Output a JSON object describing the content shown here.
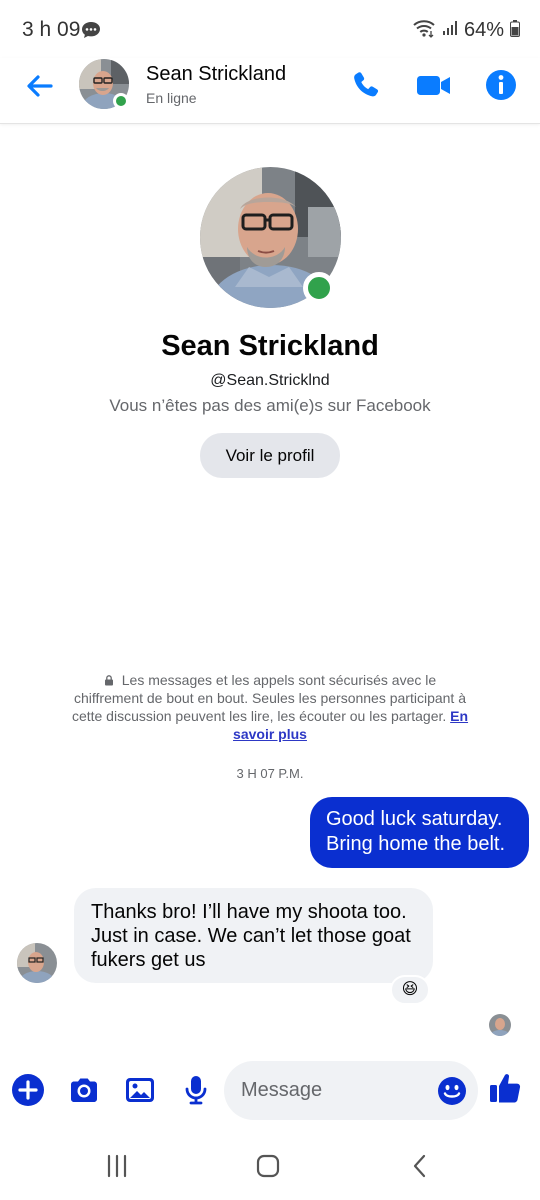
{
  "status_bar": {
    "time": "3 h 09",
    "battery": "64%",
    "icons": [
      "chat-bubble-icon",
      "wifi-icon",
      "signal-icon",
      "battery-icon"
    ]
  },
  "header": {
    "name": "Sean Strickland",
    "status": "En ligne",
    "icons": [
      "back-arrow-icon",
      "phone-icon",
      "video-icon",
      "info-icon"
    ]
  },
  "profile": {
    "name": "Sean Strickland",
    "handle": "@Sean.Stricklnd",
    "friend_status": "Vous n’êtes pas des ami(e)s sur Facebook",
    "view_profile_label": "Voir le profil"
  },
  "encryption_notice": {
    "text": "Les messages et les appels sont sécurisés avec le chiffrement de bout en bout. Seules les personnes participant à cette discussion peuvent les lire, les écouter ou les partager.",
    "link": "En savoir plus"
  },
  "conversation": {
    "timestamp": "3 H 07 P.M.",
    "messages": [
      {
        "direction": "outgoing",
        "lines": [
          "Good luck saturday.",
          "Bring home the belt."
        ]
      },
      {
        "direction": "incoming",
        "lines": [
          "Thanks bro! I’ll have my shoota too.",
          "Just in case. We can’t let those goat",
          "fukers get us"
        ],
        "reaction": "😆"
      }
    ]
  },
  "composer": {
    "placeholder": "Message",
    "icons": [
      "plus-icon",
      "camera-icon",
      "gallery-icon",
      "microphone-icon",
      "emoji-icon",
      "thumbs-up-icon"
    ]
  },
  "system_nav": {
    "icons": [
      "recent-apps-icon",
      "home-icon",
      "back-icon"
    ]
  },
  "colors": {
    "accent": "#0a7cff",
    "composer_accent": "#0a2fd0",
    "outgoing_bubble": "#0a2fd0",
    "incoming_bubble": "#f0f2f5",
    "online": "#31a24c"
  }
}
